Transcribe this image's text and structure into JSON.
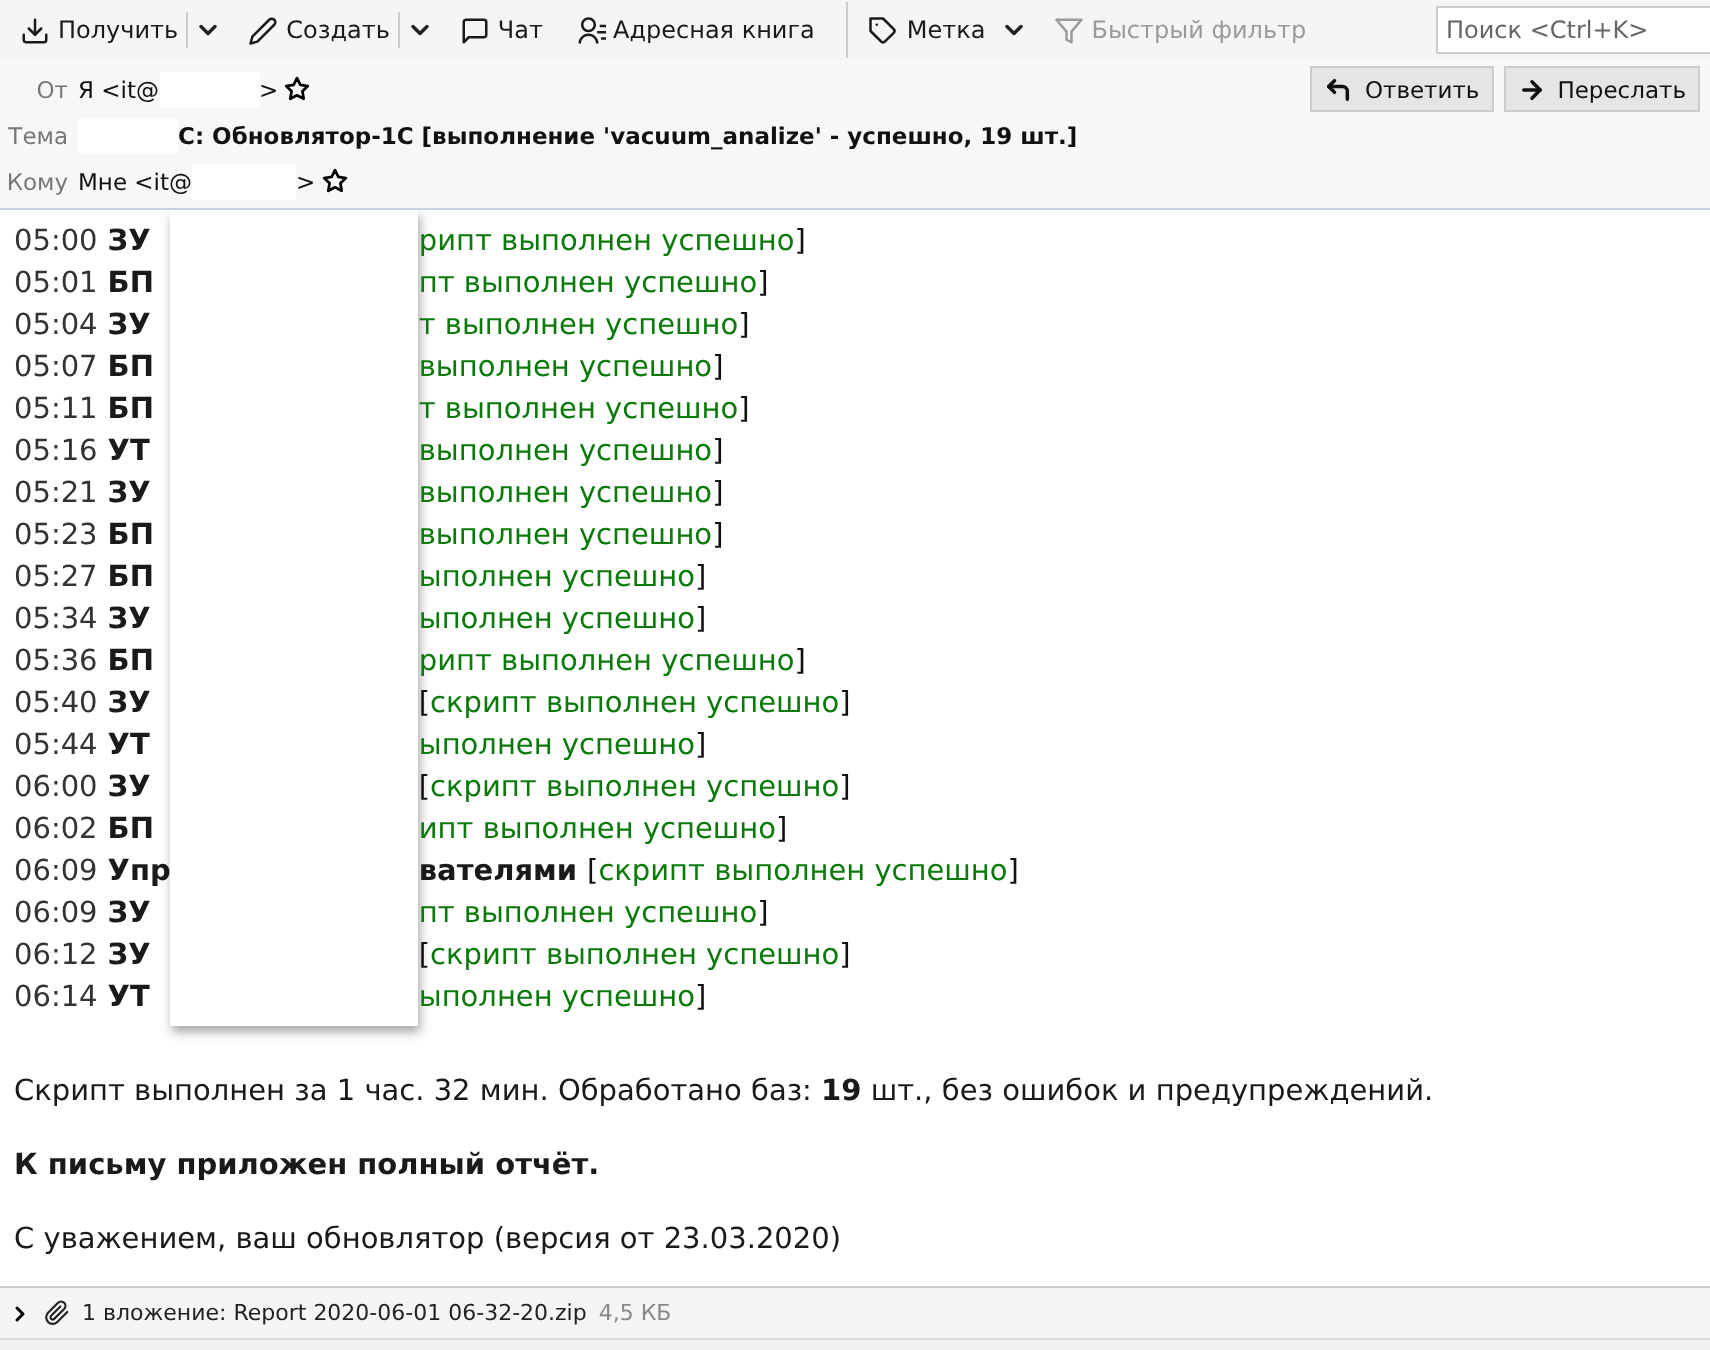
{
  "toolbar": {
    "buttons": [
      {
        "label": "Получить",
        "kind": "download",
        "dropdown": true,
        "disabled": false
      },
      {
        "label": "Создать",
        "kind": "pencil",
        "dropdown": true,
        "disabled": false
      },
      {
        "label": "Чат",
        "kind": "chat",
        "dropdown": false,
        "disabled": false
      },
      {
        "label": "Адресная книга",
        "kind": "contacts",
        "dropdown": false,
        "disabled": false
      },
      {
        "label": "Метка",
        "kind": "tag",
        "dropdown": true,
        "disabled": false
      },
      {
        "label": "Быстрый фильтр",
        "kind": "filter",
        "dropdown": false,
        "disabled": true
      }
    ],
    "search": {
      "placeholder": "Поиск <Ctrl+K>"
    }
  },
  "header": {
    "actions": [
      {
        "label": "Ответить",
        "kind": "reply"
      },
      {
        "label": "Переслать",
        "kind": "forward"
      }
    ],
    "fields": [
      {
        "label": "От",
        "kind": "address",
        "before": "Я <it@",
        "after": ">"
      },
      {
        "label": "Тема",
        "kind": "subject",
        "after": "С: Обновлятор-1С [выполнение 'vacuum_analize' - успешно, 19 шт.]"
      },
      {
        "label": "Кому",
        "kind": "address",
        "before": "Мне <it@",
        "after": ">"
      }
    ]
  },
  "log": [
    {
      "time": "05:00",
      "base": "ЗУ",
      "status": "рипт выполнен успешно",
      "close": "]"
    },
    {
      "time": "05:01",
      "base": "БП",
      "status": "пт выполнен успешно",
      "close": "]"
    },
    {
      "time": "05:04",
      "base": "ЗУ",
      "status": "т выполнен успешно",
      "close": "]"
    },
    {
      "time": "05:07",
      "base": "БП",
      "status": "выполнен успешно",
      "close": "]"
    },
    {
      "time": "05:11",
      "base": "БП",
      "status": "т выполнен успешно",
      "close": "]"
    },
    {
      "time": "05:16",
      "base": "УТ",
      "status": "выполнен успешно",
      "close": "]"
    },
    {
      "time": "05:21",
      "base": "ЗУ",
      "status": "выполнен успешно",
      "close": "]"
    },
    {
      "time": "05:23",
      "base": "БП",
      "status": "выполнен успешно",
      "close": "]"
    },
    {
      "time": "05:27",
      "base": "БП",
      "status": "ыполнен успешно",
      "close": "]"
    },
    {
      "time": "05:34",
      "base": "ЗУ",
      "status": "ыполнен успешно",
      "close": "]"
    },
    {
      "time": "05:36",
      "base": "БП",
      "status": "рипт выполнен успешно",
      "close": "]"
    },
    {
      "time": "05:40",
      "base": "ЗУ",
      "open": "[",
      "status": "скрипт выполнен успешно",
      "close": "]"
    },
    {
      "time": "05:44",
      "base": "УТ",
      "status": "ыполнен успешно",
      "close": "]"
    },
    {
      "time": "06:00",
      "base": "ЗУ",
      "open": "[",
      "status": "скрипт выполнен успешно",
      "close": "]"
    },
    {
      "time": "06:02",
      "base": "БП",
      "status": "ипт выполнен успешно",
      "close": "]"
    },
    {
      "time": "06:09",
      "base": "Упр",
      "rest": "вателями",
      "open": "[",
      "status": "скрипт выполнен успешно",
      "close": "]"
    },
    {
      "time": "06:09",
      "base": "ЗУ",
      "status": "пт выполнен успешно",
      "close": "]"
    },
    {
      "time": "06:12",
      "base": "ЗУ",
      "open": "[",
      "status": "скрипт выполнен успешно",
      "close": "]"
    },
    {
      "time": "06:14",
      "base": "УТ",
      "status": "ыполнен успешно",
      "close": "]"
    }
  ],
  "paragraphs": [
    {
      "text": "Скрипт выполнен за 1 час. 32 мин. Обработано баз: **19** шт., без ошибок и предупреждений.",
      "bold": false
    },
    {
      "text": "К письму приложен полный отчёт.",
      "bold": true
    },
    {
      "text": "С уважением, ваш обновлятор (версия от 23.03.2020)",
      "bold": false
    }
  ],
  "attachments": {
    "summary": "1 вложение: Report 2020-06-01 06-32-20.zip",
    "size": "4,5 КБ",
    "expanded": false
  }
}
